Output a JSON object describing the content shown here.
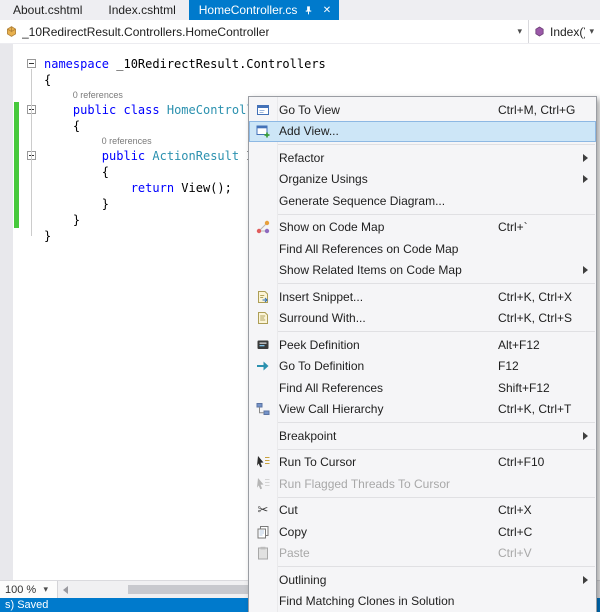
{
  "colors": {
    "accent": "#007acc",
    "menu_highlight": "#cde6f7",
    "menu_highlight_border": "#8db8e3",
    "menu_bg": "#f5f5f7",
    "keyword": "#0000ff",
    "type_name": "#2b91af",
    "change_bar": "#47c93c"
  },
  "tabs": {
    "items": [
      {
        "label": "About.cshtml",
        "active": false
      },
      {
        "label": "Index.cshtml",
        "active": false
      },
      {
        "label": "HomeController.cs",
        "active": true,
        "pinned": true,
        "closable": true
      }
    ]
  },
  "navbar": {
    "type_dropdown": {
      "value": "_10RedirectResult.Controllers.HomeController",
      "icon": "class-icon"
    },
    "member_dropdown": {
      "value": "Index()",
      "icon": "method-icon"
    }
  },
  "editor": {
    "lines": [
      {
        "kind": "code",
        "outline": true,
        "tokens": [
          {
            "text": "namespace",
            "cls": "kw"
          },
          {
            "text": " _10RedirectResult.Controllers",
            "cls": "pl"
          }
        ]
      },
      {
        "kind": "code",
        "tokens": [
          {
            "text": "{",
            "cls": "pl"
          }
        ]
      },
      {
        "kind": "lens",
        "text": "0 references",
        "indent": 4
      },
      {
        "kind": "code",
        "outline": true,
        "changed": true,
        "tokens": [
          {
            "text": "    ",
            "cls": "pl"
          },
          {
            "text": "public class",
            "cls": "kw"
          },
          {
            "text": " ",
            "cls": "pl"
          },
          {
            "text": "HomeController",
            "cls": "ty"
          }
        ]
      },
      {
        "kind": "code",
        "changed": true,
        "tokens": [
          {
            "text": "    {",
            "cls": "pl"
          }
        ]
      },
      {
        "kind": "lens",
        "text": "0 references",
        "indent": 8,
        "changed": true
      },
      {
        "kind": "code",
        "outline": true,
        "changed": true,
        "tokens": [
          {
            "text": "        ",
            "cls": "pl"
          },
          {
            "text": "public",
            "cls": "kw"
          },
          {
            "text": " ",
            "cls": "pl"
          },
          {
            "text": "ActionResult",
            "cls": "ty"
          },
          {
            "text": " Index()",
            "cls": "pl"
          }
        ]
      },
      {
        "kind": "code",
        "changed": true,
        "tokens": [
          {
            "text": "        {",
            "cls": "pl"
          }
        ]
      },
      {
        "kind": "code",
        "changed": true,
        "tokens": [
          {
            "text": "            ",
            "cls": "pl"
          },
          {
            "text": "return",
            "cls": "kw"
          },
          {
            "text": " View();",
            "cls": "pl"
          }
        ]
      },
      {
        "kind": "code",
        "changed": true,
        "tokens": [
          {
            "text": "        }",
            "cls": "pl"
          }
        ]
      },
      {
        "kind": "code",
        "changed": true,
        "tokens": [
          {
            "text": "    }",
            "cls": "pl"
          }
        ]
      },
      {
        "kind": "code",
        "tokens": [
          {
            "text": "}",
            "cls": "pl"
          }
        ]
      }
    ]
  },
  "context_menu": {
    "items": [
      {
        "label": "Go To View",
        "shortcut": "Ctrl+M, Ctrl+G",
        "icon": "go-to-view-icon"
      },
      {
        "label": "Add View...",
        "icon": "add-view-icon",
        "highlighted": true
      },
      {
        "separator": true
      },
      {
        "label": "Refactor",
        "submenu": true
      },
      {
        "label": "Organize Usings",
        "submenu": true
      },
      {
        "label": "Generate Sequence Diagram..."
      },
      {
        "separator": true
      },
      {
        "label": "Show on Code Map",
        "shortcut": "Ctrl+`",
        "icon": "code-map-icon"
      },
      {
        "label": "Find All References on Code Map"
      },
      {
        "label": "Show Related Items on Code Map",
        "submenu": true
      },
      {
        "separator": true
      },
      {
        "label": "Insert Snippet...",
        "shortcut": "Ctrl+K, Ctrl+X",
        "icon": "insert-snippet-icon"
      },
      {
        "label": "Surround With...",
        "shortcut": "Ctrl+K, Ctrl+S",
        "icon": "surround-with-icon"
      },
      {
        "separator": true
      },
      {
        "label": "Peek Definition",
        "shortcut": "Alt+F12",
        "icon": "peek-definition-icon"
      },
      {
        "label": "Go To Definition",
        "shortcut": "F12",
        "icon": "go-to-definition-icon"
      },
      {
        "label": "Find All References",
        "shortcut": "Shift+F12"
      },
      {
        "label": "View Call Hierarchy",
        "shortcut": "Ctrl+K, Ctrl+T",
        "icon": "call-hierarchy-icon"
      },
      {
        "separator": true
      },
      {
        "label": "Breakpoint",
        "submenu": true
      },
      {
        "separator": true
      },
      {
        "label": "Run To Cursor",
        "shortcut": "Ctrl+F10",
        "icon": "run-to-cursor-icon"
      },
      {
        "label": "Run Flagged Threads To Cursor",
        "disabled": true,
        "icon": "run-flagged-icon"
      },
      {
        "separator": true
      },
      {
        "label": "Cut",
        "shortcut": "Ctrl+X",
        "icon": "cut-icon"
      },
      {
        "label": "Copy",
        "shortcut": "Ctrl+C",
        "icon": "copy-icon"
      },
      {
        "label": "Paste",
        "shortcut": "Ctrl+V",
        "disabled": true,
        "icon": "paste-icon"
      },
      {
        "separator": true
      },
      {
        "label": "Outlining",
        "submenu": true
      },
      {
        "label": "Find Matching Clones in Solution"
      }
    ]
  },
  "zoom_bar": {
    "zoom_value": "100 %"
  },
  "status_bar": {
    "text": "s) Saved"
  }
}
